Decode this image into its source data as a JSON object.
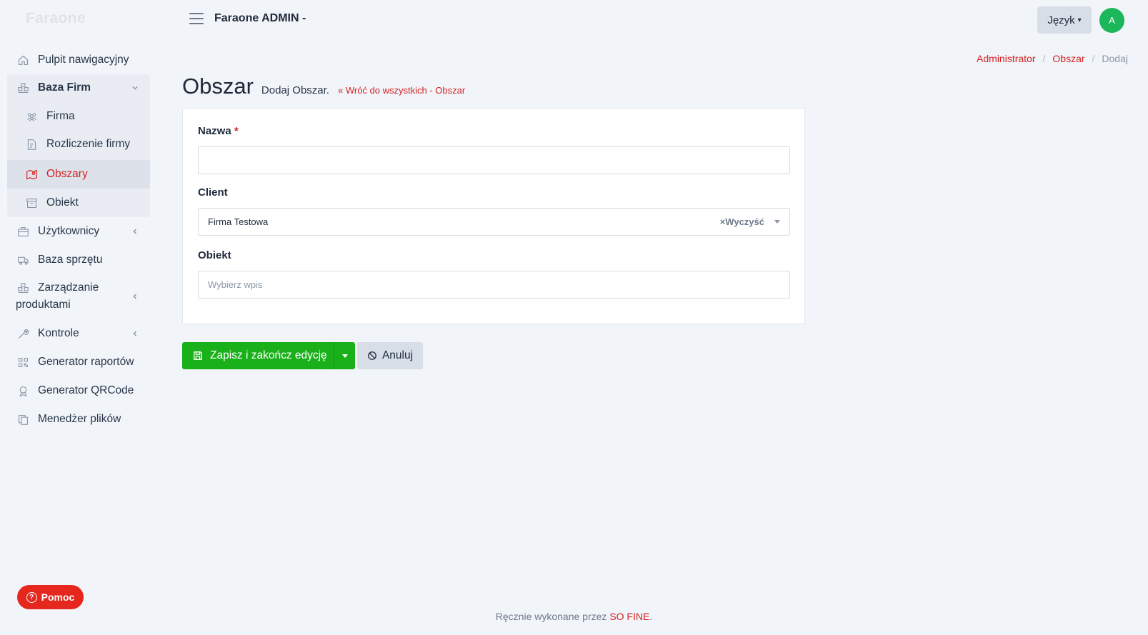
{
  "sidebar": {
    "brand": "Faraone",
    "items": [
      {
        "label": "Pulpit nawigacyjny",
        "icon": "home-icon"
      },
      {
        "label": "Baza Firm",
        "icon": "buildings-icon"
      },
      {
        "label": "Firma",
        "icon": "users-group-icon"
      },
      {
        "label": "Rozliczenie firmy",
        "icon": "invoice-icon"
      },
      {
        "label": "Obszary",
        "icon": "map-pin-icon"
      },
      {
        "label": "Obiekt",
        "icon": "archive-box-icon"
      },
      {
        "label": "Użytkownicy",
        "icon": "briefcase-icon"
      },
      {
        "label": "Baza sprzętu",
        "icon": "truck-icon"
      },
      {
        "label": "Zarządzanie produktami",
        "icon": "boxes-icon"
      },
      {
        "label": "Kontrole",
        "icon": "wrench-icon"
      },
      {
        "label": "Generator raportów",
        "icon": "qrcode-icon"
      },
      {
        "label": "Generator QRCode",
        "icon": "award-icon"
      },
      {
        "label": "Menedżer plików",
        "icon": "files-icon"
      }
    ]
  },
  "header": {
    "title": "Faraone ADMIN -",
    "language_label": "Język",
    "avatar_initial": "A"
  },
  "breadcrumb": {
    "items": [
      "Administrator",
      "Obszar"
    ],
    "current": "Dodaj"
  },
  "page": {
    "title": "Obszar",
    "subtitle": "Dodaj Obszar.",
    "back_link": "Wróć do wszystkich - Obszar"
  },
  "form": {
    "name_label": "Nazwa",
    "required_mark": "*",
    "name_value": "",
    "client_label": "Client",
    "client_value": "Firma Testowa",
    "clear_label": "×Wyczyść",
    "object_label": "Obiekt",
    "object_placeholder": "Wybierz wpis"
  },
  "actions": {
    "save_label": "Zapisz i zakończ edycję",
    "cancel_label": "Anuluj"
  },
  "footer": {
    "text": "Ręcznie wykonane przez",
    "link": "SO FINE",
    "end": "."
  },
  "help": {
    "label": "Pomoc"
  },
  "colors": {
    "accent": "#d32323",
    "success": "#1ab01a",
    "avatar": "#1bb75a",
    "background": "#f1f4f8"
  }
}
